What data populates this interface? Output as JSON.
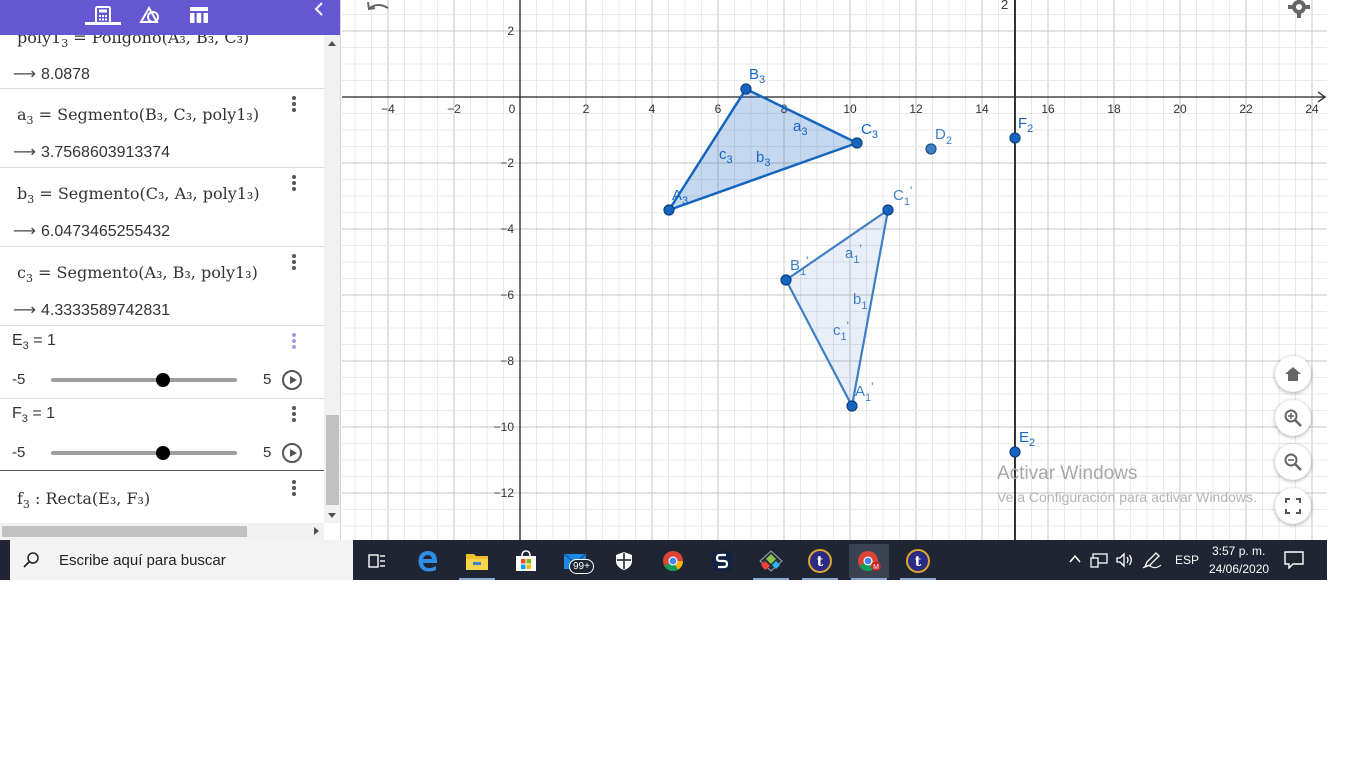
{
  "algebra": {
    "entries": [
      {
        "def_name": "poly1",
        "def_sub": "3",
        "def_rest": " = Polígono(A",
        "def_tail": "₃, B₃, C₃)",
        "value": "8.0878"
      },
      {
        "def_name": "a",
        "def_sub": "3",
        "def_rest": " = Segmento(B₃, C₃, poly1₃)",
        "value": "3.7568603913374"
      },
      {
        "def_name": "b",
        "def_sub": "3",
        "def_rest": " = Segmento(C₃, A₃, poly1₃)",
        "value": "6.0473465255432"
      },
      {
        "def_name": "c",
        "def_sub": "3",
        "def_rest": " = Segmento(A₃, B₃, poly1₃)",
        "value": "4.3333589742831"
      }
    ],
    "sliders": [
      {
        "name": "E",
        "sub": "3",
        "eq": " = 1",
        "min": "-5",
        "max": "5",
        "value": 1
      },
      {
        "name": "F",
        "sub": "3",
        "eq": " = 1",
        "min": "-5",
        "max": "5",
        "value": 1
      }
    ],
    "line_entry": {
      "name": "f",
      "sub": "3",
      "rest": " :  Recta(E₃, F₃)"
    },
    "arrow": "⟶"
  },
  "graphics": {
    "x_ticks": [
      "−4",
      "−2",
      "0",
      "2",
      "4",
      "6",
      "8",
      "10",
      "12",
      "14",
      "16",
      "18",
      "20",
      "22",
      "24"
    ],
    "y_ticks": [
      "2",
      "−2",
      "−4",
      "−6",
      "−8",
      "−10",
      "−12"
    ],
    "top_partial_label": "2",
    "points": {
      "A": "A",
      "B": "B",
      "C": "C",
      "D": "D",
      "E": "E",
      "F": "F",
      "sub2": "2",
      "sub3": "3",
      "prime_sub": "1",
      "prime": "'",
      "seg_a": "a",
      "seg_b": "b",
      "seg_c": "c"
    },
    "colors": {
      "dark_blue": "#1565c0",
      "light_blue": "#3f7fc4",
      "fill_dark": "rgba(21,101,192,0.25)",
      "fill_light": "rgba(63,127,196,0.12)"
    },
    "watermark_title": "Activar Windows",
    "watermark_sub": "Ve a Configuración para activar Windows."
  },
  "taskbar": {
    "search_placeholder": "Escribe aquí para buscar",
    "mail_badge": "99+",
    "language": "ESP",
    "time": "3:57 p. m.",
    "date": "24/06/2020"
  }
}
